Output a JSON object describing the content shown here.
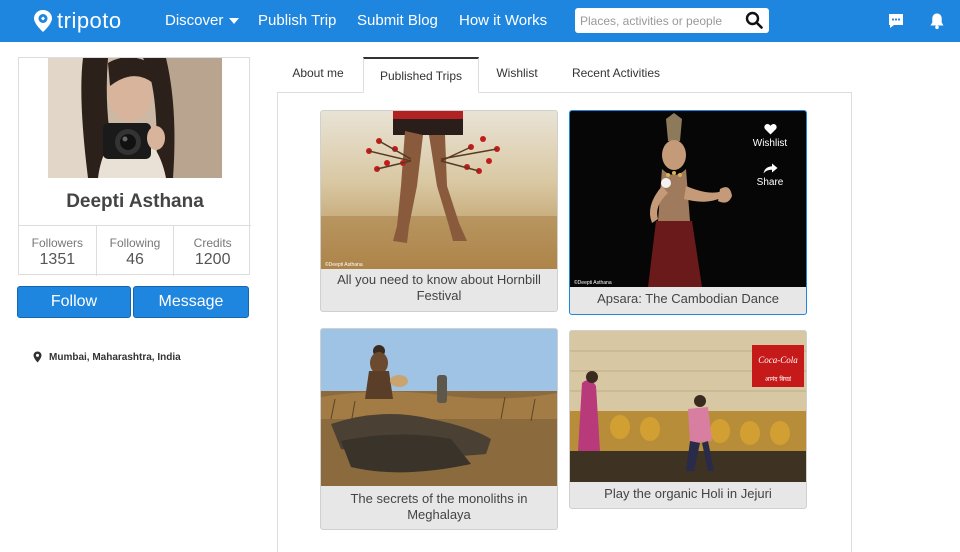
{
  "nav": {
    "logo_text": "tripoto",
    "discover": "Discover",
    "publish_trip": "Publish Trip",
    "submit_blog": "Submit Blog",
    "how_it_works": "How it Works",
    "search_placeholder": "Places, activities or people"
  },
  "profile": {
    "name": "Deepti Asthana",
    "stats": [
      {
        "label": "Followers",
        "value": "1351"
      },
      {
        "label": "Following",
        "value": "46"
      },
      {
        "label": "Credits",
        "value": "1200"
      }
    ],
    "follow_label": "Follow",
    "message_label": "Message",
    "location": "Mumbai, Maharashtra, India"
  },
  "tabs": [
    {
      "label": "About me"
    },
    {
      "label": "Published Trips"
    },
    {
      "label": "Wishlist"
    },
    {
      "label": "Recent Activities"
    }
  ],
  "trips": [
    {
      "title": "All you need to know about Hornbill Festival",
      "photo_credit": "©Deepti Asthana"
    },
    {
      "title": "Apsara: The Cambodian Dance",
      "photo_credit": "©Deepti Asthana",
      "wishlist_label": "Wishlist",
      "share_label": "Share"
    },
    {
      "title": "The secrets of the monoliths in Meghalaya"
    },
    {
      "title": "Play the organic Holi in Jejuri",
      "sign_text": "Coca-Cola",
      "sign_subtext": "आनंद बिघडं"
    }
  ],
  "colors": {
    "brand_blue": "#1f86e0",
    "card_bg": "#e7e7e7"
  }
}
